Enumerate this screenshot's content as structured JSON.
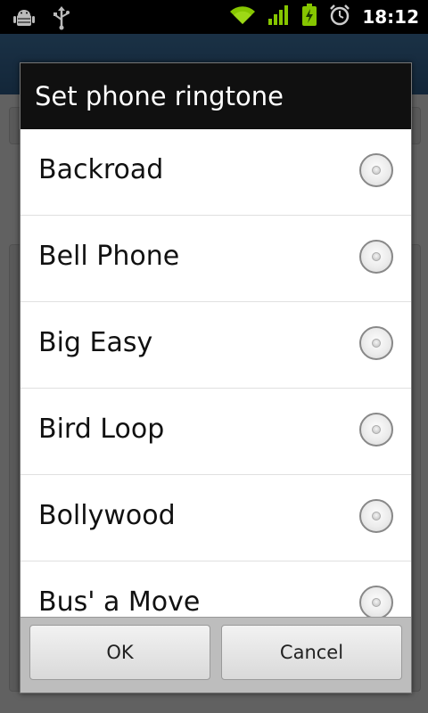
{
  "status_bar": {
    "time": "18:12",
    "icons": [
      "android-debug-icon",
      "usb-icon",
      "wifi-icon",
      "signal-icon",
      "battery-charging-icon",
      "alarm-icon"
    ],
    "accent": "#86c600"
  },
  "dialog": {
    "title": "Set phone ringtone",
    "items": [
      {
        "label": "Backroad",
        "selected": false
      },
      {
        "label": "Bell Phone",
        "selected": false
      },
      {
        "label": "Big Easy",
        "selected": false
      },
      {
        "label": "Bird Loop",
        "selected": false
      },
      {
        "label": "Bollywood",
        "selected": false
      },
      {
        "label": "Bus' a Move",
        "selected": false
      }
    ],
    "buttons": {
      "ok_label": "OK",
      "cancel_label": "Cancel"
    }
  }
}
